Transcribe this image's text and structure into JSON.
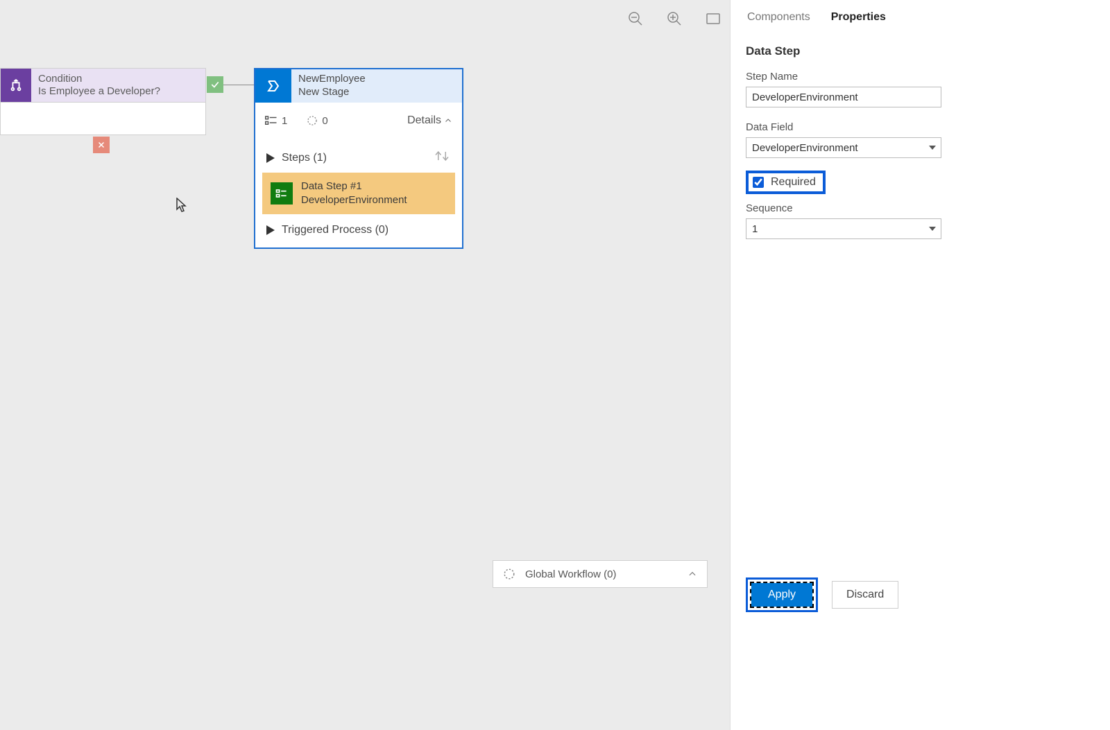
{
  "canvas": {
    "condition": {
      "title": "Condition",
      "subtitle": "Is Employee a Developer?"
    },
    "stage": {
      "title": "NewEmployee",
      "subtitle": "New Stage",
      "meta_count_a": "1",
      "meta_count_b": "0",
      "details_label": "Details",
      "steps_label": "Steps (1)",
      "step_item_title": "Data Step #1",
      "step_item_subtitle": "DeveloperEnvironment",
      "triggered_label": "Triggered Process (0)"
    },
    "global_workflow": "Global Workflow (0)"
  },
  "panel": {
    "tab_components": "Components",
    "tab_properties": "Properties",
    "title": "Data Step",
    "step_name_label": "Step Name",
    "step_name_value": "DeveloperEnvironment",
    "data_field_label": "Data Field",
    "data_field_value": "DeveloperEnvironment",
    "required_label": "Required",
    "sequence_label": "Sequence",
    "sequence_value": "1",
    "apply_label": "Apply",
    "discard_label": "Discard"
  }
}
